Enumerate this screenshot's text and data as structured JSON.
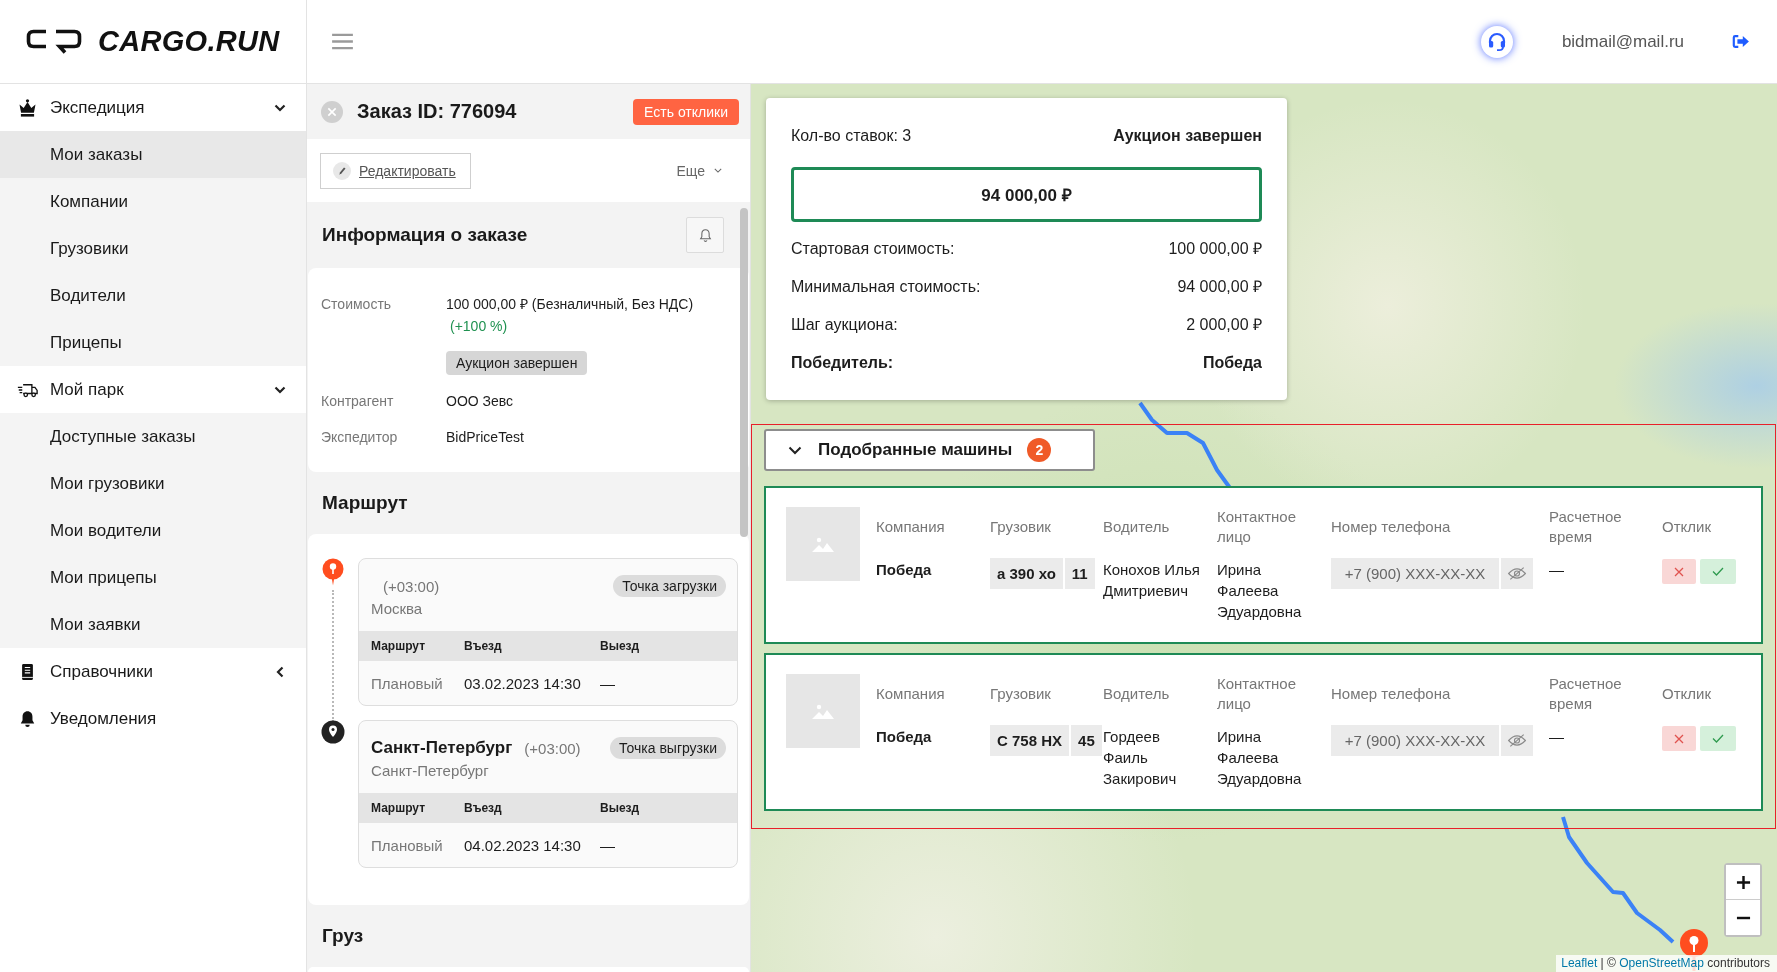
{
  "header": {
    "logo": "CARGO.RUN",
    "user_email": "bidmail@mail.ru"
  },
  "sidebar": {
    "groups": [
      {
        "label": "Экспедиция",
        "expanded": true,
        "children": [
          {
            "label": "Мои заказы",
            "selected": true
          },
          {
            "label": "Компании",
            "selected": false
          },
          {
            "label": "Грузовики",
            "selected": false
          },
          {
            "label": "Водители",
            "selected": false
          },
          {
            "label": "Прицепы",
            "selected": false
          }
        ]
      },
      {
        "label": "Мой парк",
        "expanded": true,
        "children": [
          {
            "label": "Доступные заказы",
            "selected": false
          },
          {
            "label": "Мои грузовики",
            "selected": false
          },
          {
            "label": "Мои водители",
            "selected": false
          },
          {
            "label": "Мои прицепы",
            "selected": false
          },
          {
            "label": "Мои заявки",
            "selected": false
          }
        ]
      },
      {
        "label": "Справочники",
        "expanded": false
      },
      {
        "label": "Уведомления"
      }
    ]
  },
  "order": {
    "title": "Заказ ID: 776094",
    "badge": "Есть отклики",
    "edit_button": "Редактировать",
    "more_button": "Еще",
    "info": {
      "heading": "Информация о заказе",
      "rows": [
        {
          "label": "Стоимость",
          "value": "100 000,00 ₽ (Безналичный, Без НДС)",
          "note": "(+100 %)",
          "tag": "Аукцион завершен"
        },
        {
          "label": "Контрагент",
          "value": "ООО Зевс"
        },
        {
          "label": "Экспедитор",
          "value": "BidPriceTest"
        }
      ]
    },
    "route": {
      "heading": "Маршрут",
      "points": [
        {
          "kind": "loading",
          "color": "#ff4d1f",
          "timezone": "(+03:00)",
          "region": "Москва",
          "tag": "Точка загрузки",
          "columns": [
            "Маршрут",
            "Въезд",
            "Выезд"
          ],
          "row": [
            "Плановый",
            "03.02.2023 14:30",
            "—"
          ]
        },
        {
          "kind": "unloading",
          "color": "#222222",
          "city": "Санкт-Петербург",
          "timezone": "(+03:00)",
          "region": "Санкт-Петербург",
          "tag": "Точка выгрузки",
          "columns": [
            "Маршрут",
            "Въезд",
            "Выезд"
          ],
          "row": [
            "Плановый",
            "04.02.2023 14:30",
            "—"
          ]
        }
      ]
    },
    "cargo": {
      "heading": "Груз"
    }
  },
  "map": {
    "auction": {
      "bids": "Кол-во ставок: 3",
      "status": "Аукцион завершен",
      "current_price": "94 000,00 ₽",
      "rows": [
        {
          "label": "Стартовая стоимость:",
          "value": "100 000,00 ₽",
          "bold": false
        },
        {
          "label": "Минимальная стоимость:",
          "value": "94 000,00 ₽",
          "bold": false
        },
        {
          "label": "Шаг аукциона:",
          "value": "2 000,00 ₽",
          "bold": false
        },
        {
          "label": "Победитель:",
          "value": "Победа",
          "bold": true
        }
      ]
    },
    "matched": {
      "title": "Подобранные машины",
      "count": "2",
      "expanded": true,
      "vehicles": [
        {
          "company_label": "Компания",
          "company": "Победа",
          "truck_label": "Грузовик",
          "plate": "а 390 хо",
          "plate_region": "11",
          "driver_label": "Водитель",
          "driver": "Конохов Илья Дмитриевич",
          "contact_label": "Контактное лицо",
          "contact": "Ирина Фалеева Эдуардовна",
          "phone_label": "Номер телефона",
          "phone": "+7 (900) XXX-XX-XX",
          "eta_label": "Расчетное время",
          "eta": "—",
          "response_label": "Отклик"
        },
        {
          "company_label": "Компания",
          "company": "Победа",
          "truck_label": "Грузовик",
          "plate": "С 758 НХ",
          "plate_region": "45",
          "driver_label": "Водитель",
          "driver": "Гордеев Фаиль Закирович",
          "contact_label": "Контактное лицо",
          "contact": "Ирина Фалеева Эдуардовна",
          "phone_label": "Номер телефона",
          "phone": "+7 (900) XXX-XX-XX",
          "eta_label": "Расчетное время",
          "eta": "—",
          "response_label": "Отклик"
        }
      ]
    },
    "attribution": [
      {
        "kind": "link",
        "text": "Leaflet"
      },
      {
        "kind": "text",
        "text": "| ©"
      },
      {
        "kind": "link",
        "text": "OpenStreetMap"
      },
      {
        "kind": "text",
        "text": "contributors"
      }
    ]
  }
}
